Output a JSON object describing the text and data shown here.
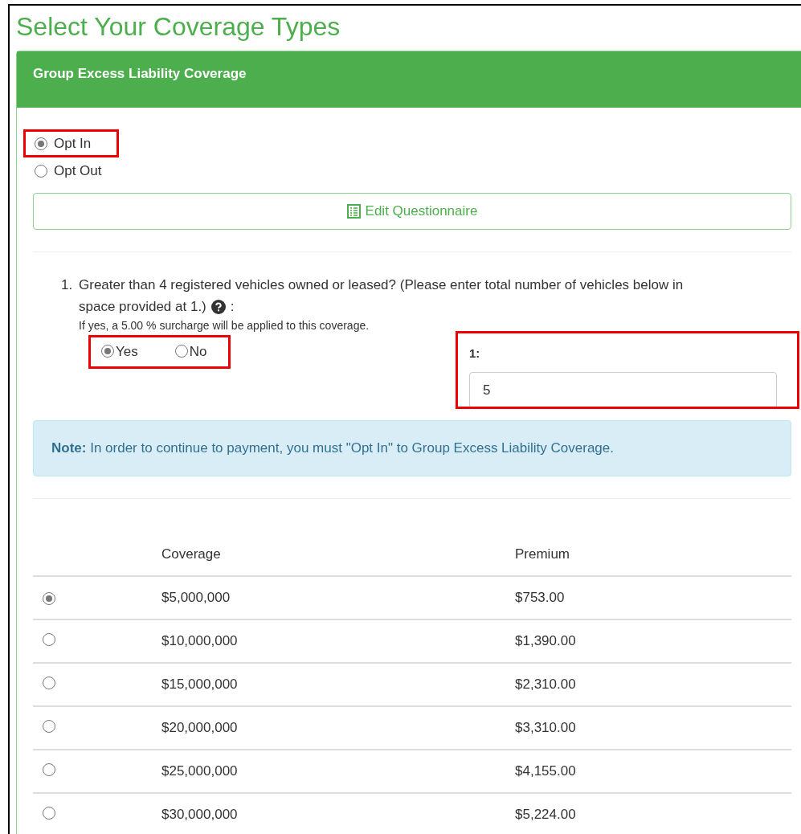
{
  "page_title": "Select Your Coverage Types",
  "panel": {
    "title": "Group Excess Liability Coverage",
    "participation": [
      {
        "label": "Opt In",
        "selected": true,
        "highlighted": true
      },
      {
        "label": "Opt Out",
        "selected": false,
        "highlighted": false
      }
    ],
    "edit_button": "Edit Questionnaire",
    "questions": [
      {
        "number": "1.",
        "text_lines": [
          "Greater than 4 registered vehicles owned or leased? (Please enter total number of vehicles below in",
          "space provided at 1.)"
        ],
        "suffix": ":",
        "hint": "If yes, a 5.00 % surcharge will be applied to this coverage.",
        "answers_highlighted": true,
        "answers": [
          {
            "label": "Yes",
            "selected": true
          },
          {
            "label": "No",
            "selected": false
          }
        ],
        "field": {
          "label": "1:",
          "value": "5",
          "highlighted": true
        }
      }
    ],
    "note": {
      "lead": "Note:",
      "text": "In order to continue to payment, you must \"Opt In\" to Group Excess Liability Coverage."
    },
    "table": {
      "columns": [
        "Coverage",
        "Premium"
      ],
      "rows": [
        {
          "coverage": "$5,000,000",
          "premium": "$753.00",
          "selected": true
        },
        {
          "coverage": "$10,000,000",
          "premium": "$1,390.00",
          "selected": false
        },
        {
          "coverage": "$15,000,000",
          "premium": "$2,310.00",
          "selected": false
        },
        {
          "coverage": "$20,000,000",
          "premium": "$3,310.00",
          "selected": false
        },
        {
          "coverage": "$25,000,000",
          "premium": "$4,155.00",
          "selected": false
        },
        {
          "coverage": "$30,000,000",
          "premium": "$5,224.00",
          "selected": false
        }
      ]
    }
  }
}
